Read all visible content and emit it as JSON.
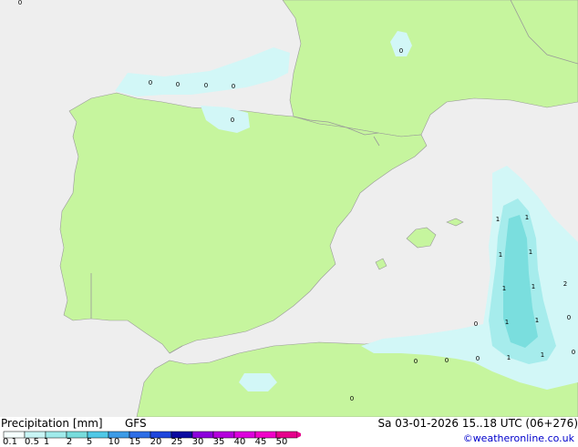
{
  "legend": {
    "title": "Precipitation [mm]",
    "model": "GFS",
    "datetime": "Sa 03-01-2026 15..18 UTC (06+276)",
    "credit": "©weatheronline.co.uk",
    "ticks": [
      "0.1",
      "0.5",
      "1",
      "2",
      "5",
      "10",
      "15",
      "20",
      "25",
      "30",
      "35",
      "40",
      "45",
      "50"
    ],
    "colors": [
      "#f5fffe",
      "#c8f5f5",
      "#a0ebeb",
      "#78dcdc",
      "#50c8e6",
      "#3c9be6",
      "#2d6ee6",
      "#1e46dc",
      "#0a0aa0",
      "#8c00dc",
      "#b400dc",
      "#dc00dc",
      "#f000c8",
      "#e6008c"
    ]
  },
  "map_colors": {
    "sea": "#eeeeee",
    "land": "#c6f59e",
    "border": "#999999",
    "precip_light": "#d2f7f7",
    "precip_medium": "#a6ecec",
    "precip_heavy": "#7adede"
  },
  "map_labels": [
    "0",
    "0",
    "0",
    "0",
    "0",
    "0",
    "0",
    "1",
    "1",
    "1",
    "1",
    "2",
    "1",
    "1",
    "0",
    "1",
    "1",
    "0",
    "1",
    "1",
    "0",
    "0",
    "0",
    "0",
    "0"
  ]
}
